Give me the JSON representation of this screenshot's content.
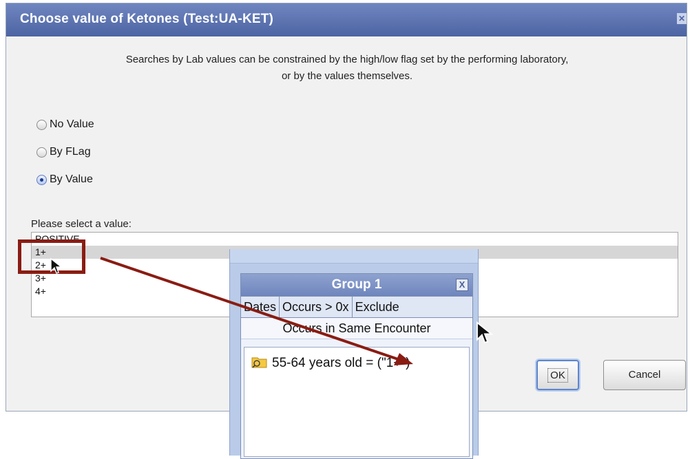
{
  "dialog": {
    "title": "Choose value of Ketones (Test:UA-KET)",
    "close_glyph": "✕",
    "intro_line1": "Searches by Lab values can be constrained by the high/low flag set by the performing laboratory,",
    "intro_line2": "or by the values themselves.",
    "radios": [
      {
        "label": "No Value",
        "checked": false
      },
      {
        "label": "By FLag",
        "checked": false
      },
      {
        "label": "By Value",
        "checked": true
      }
    ],
    "select_label": "Please select a value:",
    "options": [
      {
        "label": "POSITIVE",
        "selected": false
      },
      {
        "label": "1+",
        "selected": true
      },
      {
        "label": "2+",
        "selected": false
      },
      {
        "label": "3+",
        "selected": false
      },
      {
        "label": "4+",
        "selected": false
      }
    ],
    "ok_label": "OK",
    "cancel_label": "Cancel"
  },
  "group": {
    "title": "Group 1",
    "close_glyph": "X",
    "tabs": [
      "Dates",
      "Occurs > 0x",
      "Exclude"
    ],
    "same_encounter": "Occurs in Same Encounter",
    "entry": "55-64 years old = (\"1+\")"
  },
  "colors": {
    "title_bar": "#5a70ad",
    "annotation": "#8a1c13",
    "ok_focus": "#5e84c9"
  },
  "icons": [
    "folder-search-icon",
    "close-icon",
    "mouse-cursor-icon"
  ]
}
